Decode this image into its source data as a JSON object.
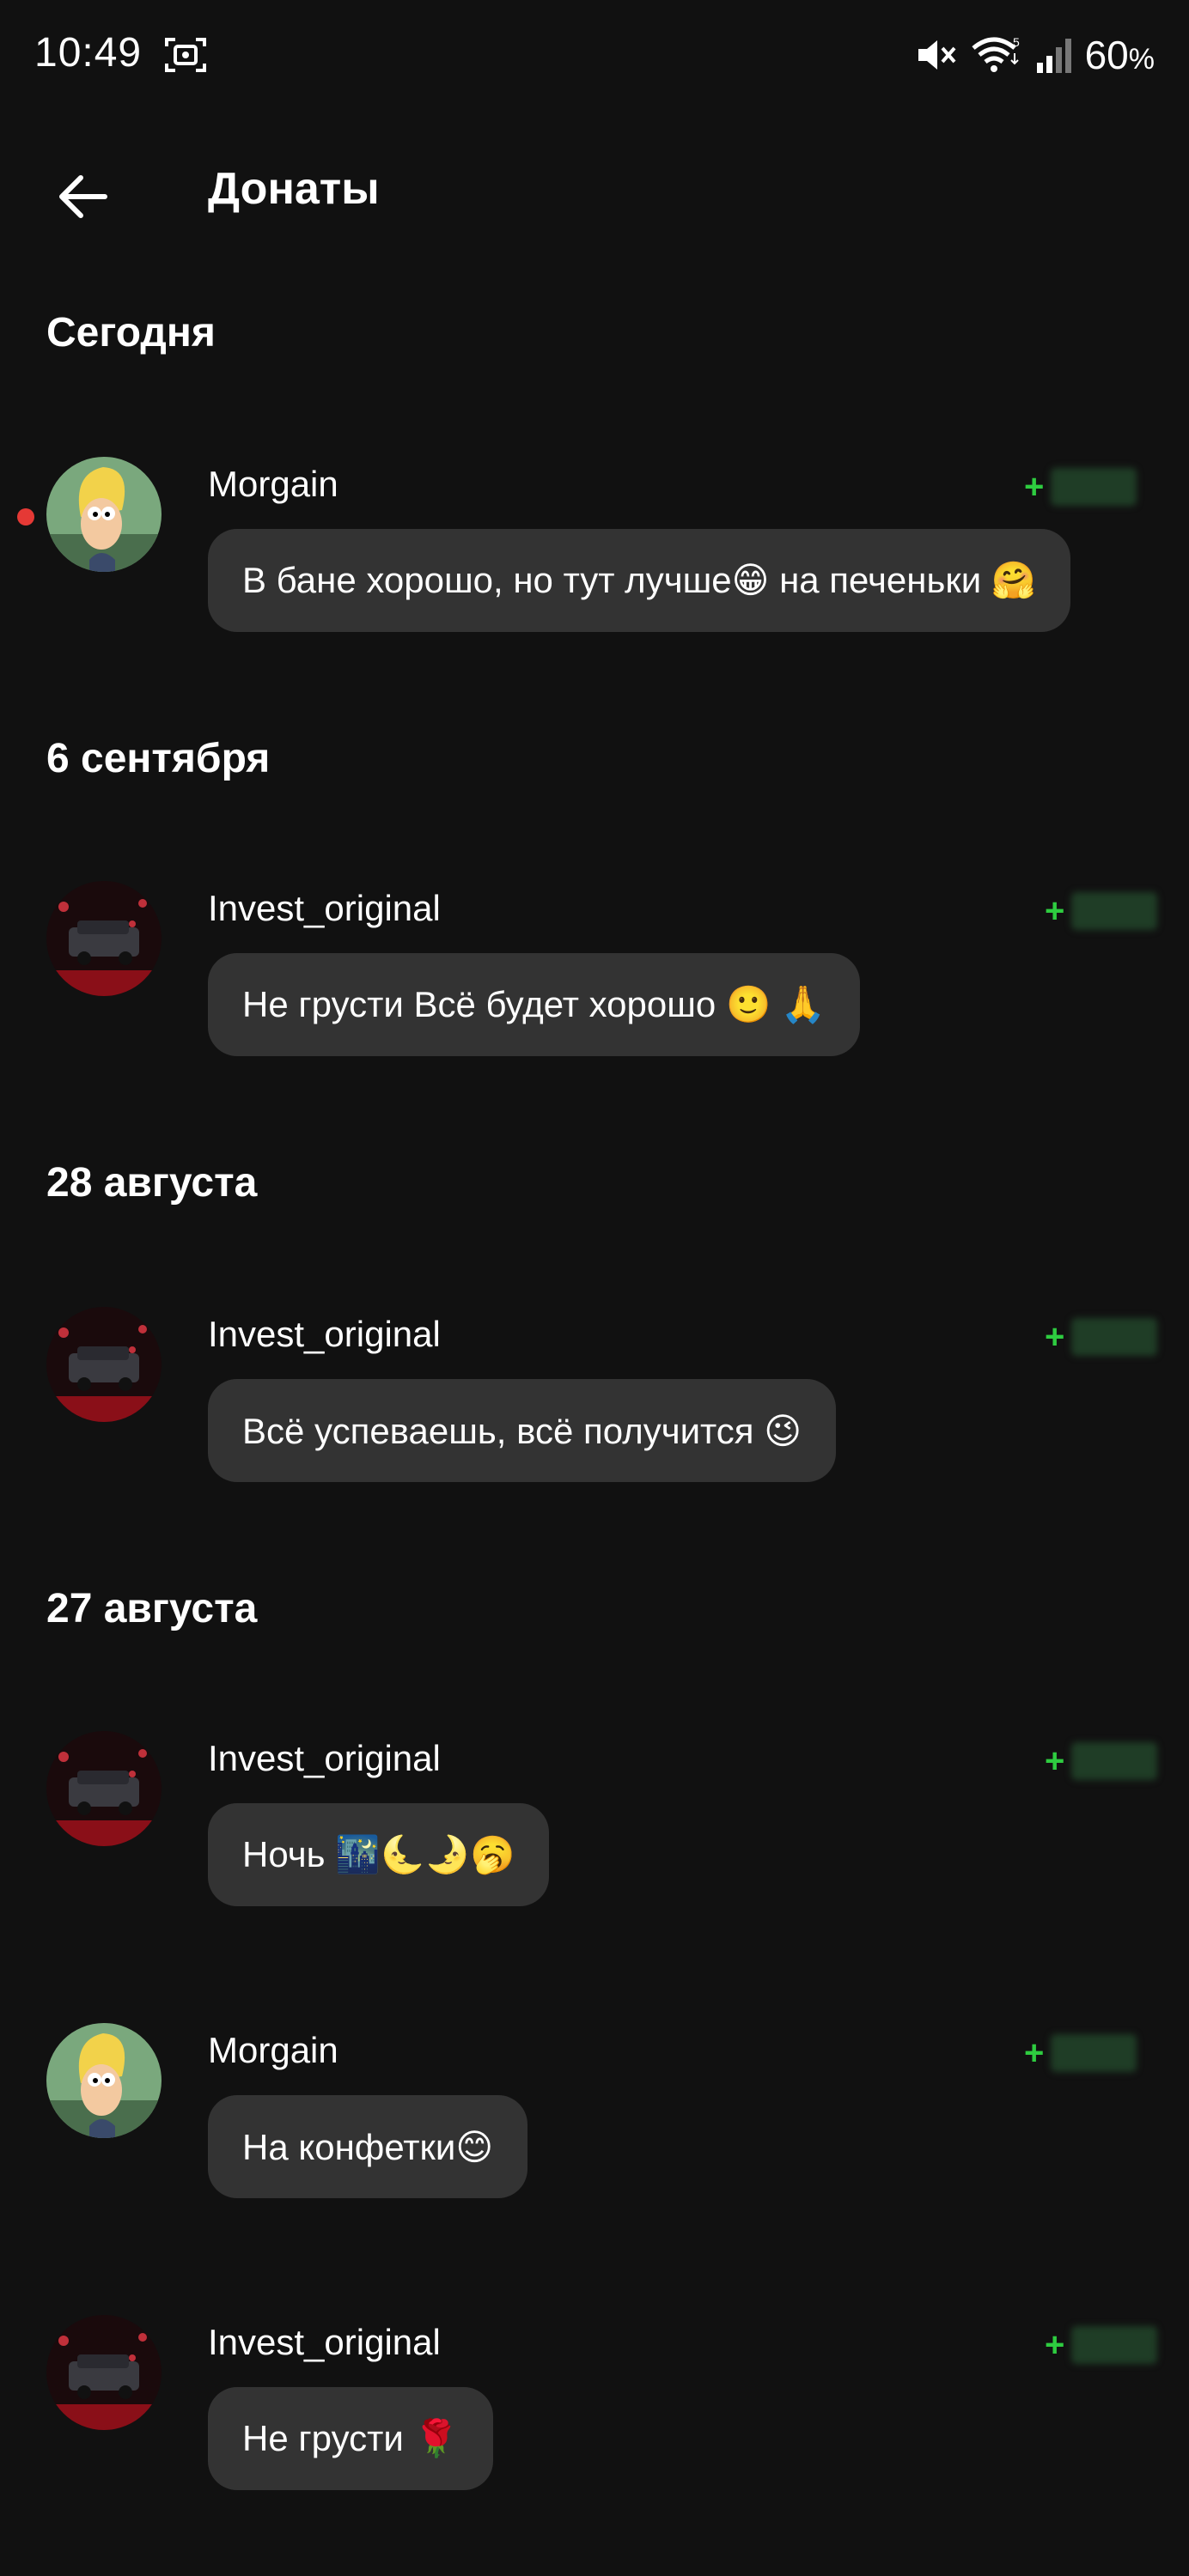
{
  "status_bar": {
    "time": "10:49",
    "battery": "60",
    "battery_unit": "%",
    "wifi_badge": "5",
    "icons": [
      "screenshot-icon",
      "mute-icon",
      "wifi-icon",
      "signal-icon"
    ]
  },
  "header": {
    "title": "Донаты",
    "back_icon": "arrow-left-icon"
  },
  "colors": {
    "background": "#111111",
    "bubble": "#333333",
    "accent_green": "#2ecc40",
    "unread_dot": "#e53935"
  },
  "sections": [
    {
      "title": "Сегодня",
      "items": [
        {
          "name": "Morgain",
          "amount_sign": "+",
          "message": "В бане хорошо, но тут лучше😁 на печеньки 🤗",
          "avatar": "cartoon-avatar",
          "unread": true
        }
      ]
    },
    {
      "title": "6 сентября",
      "items": [
        {
          "name": "Invest_original",
          "amount_sign": "+",
          "message": "Не грусти  Всё будет хорошо 🙂 🙏",
          "avatar": "car-avatar",
          "unread": false
        }
      ]
    },
    {
      "title": "28 августа",
      "items": [
        {
          "name": "Invest_original",
          "amount_sign": "+",
          "message": "Всё успеваешь, всё получится 😉",
          "avatar": "car-avatar",
          "unread": false
        }
      ]
    },
    {
      "title": "27 августа",
      "items": [
        {
          "name": "Invest_original",
          "amount_sign": "+",
          "message": "Ночь 🌃🌜🌛🥱",
          "avatar": "car-avatar",
          "unread": false
        },
        {
          "name": "Morgain",
          "amount_sign": "+",
          "message": "На конфетки😊",
          "avatar": "cartoon-avatar",
          "unread": false
        },
        {
          "name": "Invest_original",
          "amount_sign": "+",
          "message": "Не грусти 🌹",
          "avatar": "car-avatar",
          "unread": false
        }
      ]
    }
  ]
}
